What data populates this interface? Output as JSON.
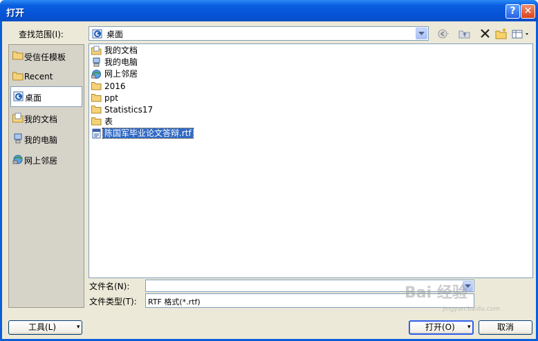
{
  "window": {
    "title": "打开"
  },
  "titlebar": {
    "help_label": "?",
    "close_label": "✕"
  },
  "lookin": {
    "label": "查找范围(I):",
    "value": "桌面"
  },
  "places": [
    {
      "label": "受信任模板",
      "icon": "folder-icon"
    },
    {
      "label": "Recent",
      "icon": "folder-icon"
    },
    {
      "label": "桌面",
      "icon": "desktop-icon",
      "selected": true
    },
    {
      "label": "我的文档",
      "icon": "documents-icon"
    },
    {
      "label": "我的电脑",
      "icon": "computer-icon"
    },
    {
      "label": "网上邻居",
      "icon": "network-icon"
    }
  ],
  "files": [
    {
      "label": "我的文档",
      "icon": "documents-icon"
    },
    {
      "label": "我的电脑",
      "icon": "computer-icon"
    },
    {
      "label": "网上邻居",
      "icon": "network-icon"
    },
    {
      "label": "2016",
      "icon": "folder-icon"
    },
    {
      "label": "ppt",
      "icon": "folder-icon"
    },
    {
      "label": "Statistics17",
      "icon": "folder-icon"
    },
    {
      "label": "表",
      "icon": "folder-icon"
    },
    {
      "label": "陈国军毕业论文答辩.rtf",
      "icon": "rtf-file-icon",
      "selected": true
    }
  ],
  "filename": {
    "label": "文件名(N):",
    "value": ""
  },
  "filetype": {
    "label": "文件类型(T):",
    "value": "RTF 格式(*.rtf)"
  },
  "buttons": {
    "tools": "工具(L)",
    "open": "打开(O)",
    "cancel": "取消"
  },
  "watermark": {
    "text": "Bai 经验",
    "sub": "jingyan.baidu.com"
  },
  "colors": {
    "titlebar": "#0653d6",
    "selection": "#316ac5",
    "dialog_bg": "#ece9d8"
  }
}
